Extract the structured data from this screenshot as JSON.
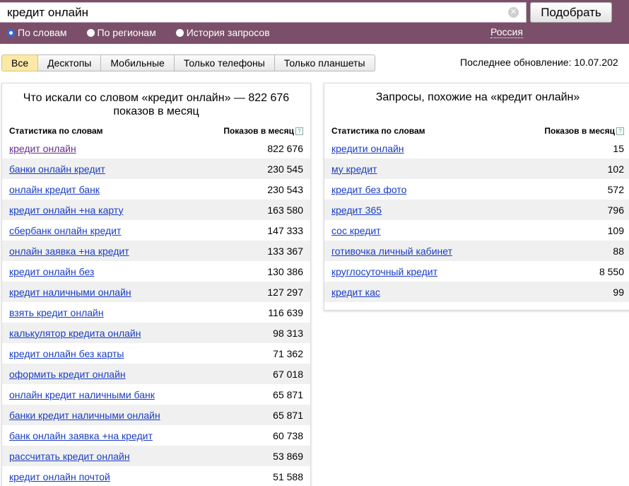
{
  "header": {
    "query": "кредит онлайн",
    "submit_label": "Подобрать",
    "clear_symbol": "✕",
    "modes": [
      {
        "label": "По словам",
        "selected": true
      },
      {
        "label": "По регионам",
        "selected": false
      },
      {
        "label": "История запросов",
        "selected": false
      }
    ],
    "region": "Россия"
  },
  "tabs": [
    "Все",
    "Десктопы",
    "Мобильные",
    "Только телефоны",
    "Только планшеты"
  ],
  "last_update": "Последнее обновление: 10.07.202",
  "left_panel": {
    "title": "Что искали со словом «кредит онлайн» — 822 676 показов в месяц",
    "col_words": "Статистика по словам",
    "col_shows": "Показов в месяц",
    "help": "?",
    "rows": [
      {
        "kw": "кредит онлайн",
        "count": "822 676"
      },
      {
        "kw": "банки онлайн кредит",
        "count": "230 545"
      },
      {
        "kw": "онлайн кредит банк",
        "count": "230 543"
      },
      {
        "kw": "кредит онлайн +на карту",
        "count": "163 580"
      },
      {
        "kw": "сбербанк онлайн кредит",
        "count": "147 333"
      },
      {
        "kw": "онлайн заявка +на кредит",
        "count": "133 367"
      },
      {
        "kw": "кредит онлайн без",
        "count": "130 386"
      },
      {
        "kw": "кредит наличными онлайн",
        "count": "127 297"
      },
      {
        "kw": "взять кредит онлайн",
        "count": "116 639"
      },
      {
        "kw": "калькулятор кредита онлайн",
        "count": "98 313"
      },
      {
        "kw": "кредит онлайн без карты",
        "count": "71 362"
      },
      {
        "kw": "оформить кредит онлайн",
        "count": "67 018"
      },
      {
        "kw": "онлайн кредит наличными банк",
        "count": "65 871"
      },
      {
        "kw": "банки кредит наличными онлайн",
        "count": "65 871"
      },
      {
        "kw": "банк онлайн заявка +на кредит",
        "count": "60 738"
      },
      {
        "kw": "рассчитать кредит онлайн",
        "count": "53 869"
      },
      {
        "kw": "кредит онлайн почтой",
        "count": "51 588"
      }
    ]
  },
  "right_panel": {
    "title": "Запросы, похожие на «кредит онлайн»",
    "col_words": "Статистика по словам",
    "col_shows": "Показов в месяц",
    "help": "?",
    "rows": [
      {
        "kw": "кредити онлайн",
        "count": "15"
      },
      {
        "kw": "му кредит",
        "count": "102"
      },
      {
        "kw": "кредит без фото",
        "count": "572"
      },
      {
        "kw": "кредит 365",
        "count": "796"
      },
      {
        "kw": "сос кредит",
        "count": "109"
      },
      {
        "kw": "готивочка личный кабинет",
        "count": "88"
      },
      {
        "kw": "круглосуточный кредит",
        "count": "8 550"
      },
      {
        "kw": "кредит кас",
        "count": "99"
      }
    ]
  },
  "colors": {
    "header_bg": "#7b4f6a",
    "link": "#1a3dc1",
    "visited_link": "#6a2d8f",
    "active_tab": "#fce9a7",
    "radio_selected": "#2f6bd8"
  }
}
